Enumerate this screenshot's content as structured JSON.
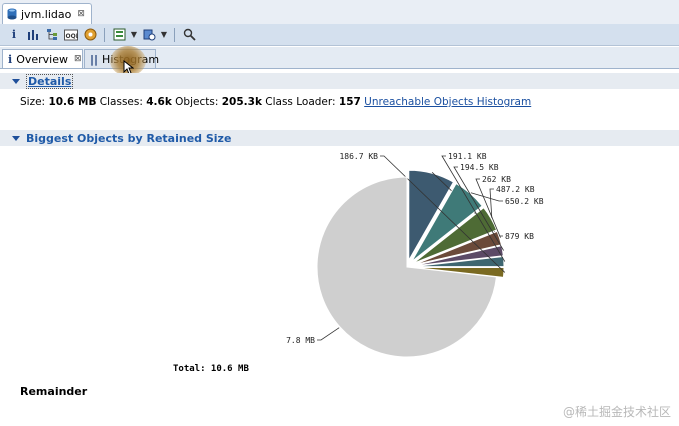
{
  "editor_tab": {
    "label": "jvm.lidao",
    "close": "⊠"
  },
  "toolbar": {
    "icons": [
      "info-icon",
      "histogram-icon",
      "dominator-tree-icon",
      "oql-icon",
      "heap-dump-overview-icon",
      "query-browser-icon",
      "find-object-icon",
      "search-icon"
    ]
  },
  "view_tabs": [
    {
      "icon": "i",
      "label": "Overview",
      "close": "⊠",
      "active": true
    },
    {
      "icon": "||",
      "label": "Histogram",
      "active": false
    }
  ],
  "details": {
    "title": "Details",
    "size_label": "Size:",
    "size_value": "10.6 MB",
    "classes_label": "Classes:",
    "classes_value": "4.6k",
    "objects_label": "Objects:",
    "objects_value": "205.3k",
    "loader_label": "Class Loader:",
    "loader_value": "157",
    "link": "Unreachable Objects Histogram"
  },
  "biggest": {
    "title": "Biggest Objects by Retained Size"
  },
  "chart_data": {
    "type": "pie",
    "title": "",
    "slices": [
      {
        "label": "879 KB",
        "value": 879,
        "color": "#3d5a70"
      },
      {
        "label": "650.2 KB",
        "value": 650.2,
        "color": "#3f7a78"
      },
      {
        "label": "487.2 KB",
        "value": 487.2,
        "color": "#4e6b35"
      },
      {
        "label": "262 KB",
        "value": 262,
        "color": "#6b4a3a"
      },
      {
        "label": "194.5 KB",
        "value": 194.5,
        "color": "#5c4a66"
      },
      {
        "label": "191.1 KB",
        "value": 191.1,
        "color": "#3e6670"
      },
      {
        "label": "186.7 KB",
        "value": 186.7,
        "color": "#7a6a22"
      },
      {
        "label": "7.8 MB",
        "value": 7800,
        "color": "#cfcfcf",
        "remainder": true
      }
    ],
    "total_label": "Total: 10.6 MB"
  },
  "remainder_label": "Remainder",
  "watermark": "@稀土掘金技术社区"
}
